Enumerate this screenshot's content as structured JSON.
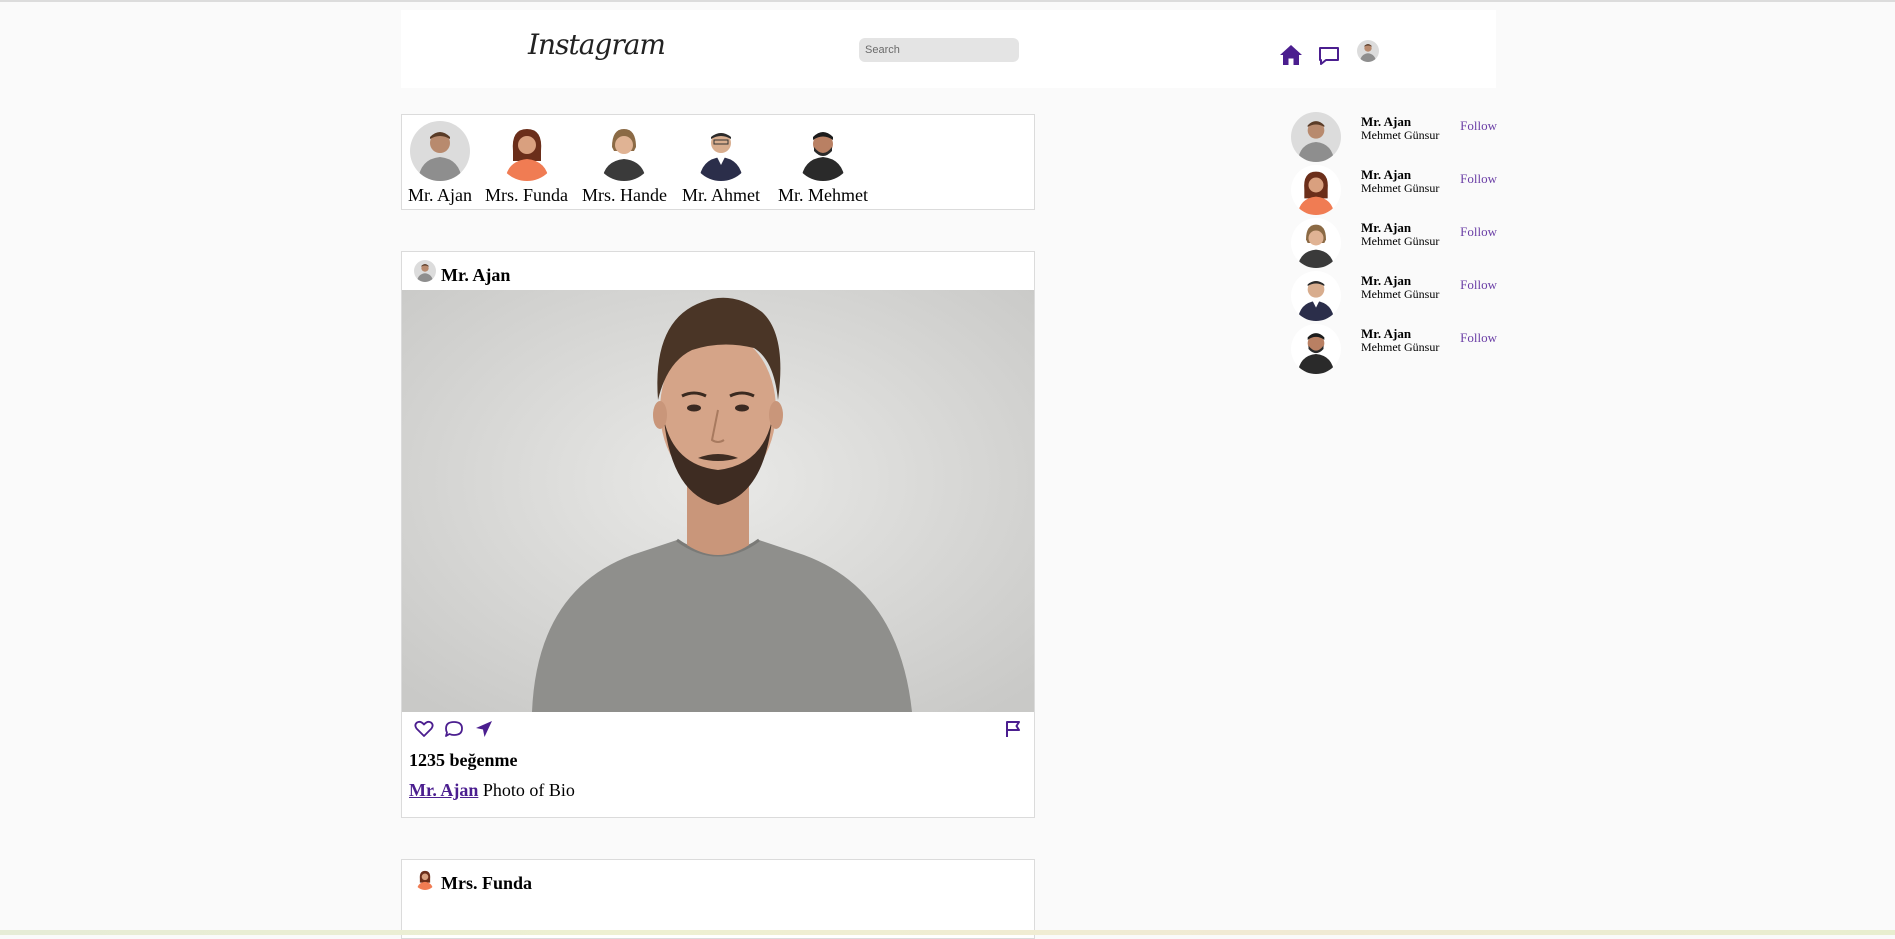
{
  "header": {
    "logo": "Instagram",
    "search_placeholder": "Search",
    "icons": [
      "home-icon",
      "message-icon",
      "profile-avatar"
    ],
    "accent_color": "#4b1e8f"
  },
  "stories": [
    {
      "label": "Mr. Ajan"
    },
    {
      "label": "Mrs. Funda"
    },
    {
      "label": "Mrs. Hande"
    },
    {
      "label": "Mr. Ahmet"
    },
    {
      "label": "Mr. Mehmet"
    }
  ],
  "posts": [
    {
      "user": "Mr. Ajan",
      "likes": "1235 beğenme",
      "caption_user": "Mr. Ajan",
      "caption_text": " Photo of Bio",
      "actions": [
        "heart-icon",
        "comment-icon",
        "share-icon",
        "flag-icon"
      ]
    },
    {
      "user": "Mrs. Funda"
    }
  ],
  "suggestions": [
    {
      "name": "Mr. Ajan",
      "subtitle": "Mehmet Günsur",
      "action": "Follow"
    },
    {
      "name": "Mr. Ajan",
      "subtitle": "Mehmet Günsur",
      "action": "Follow"
    },
    {
      "name": "Mr. Ajan",
      "subtitle": "Mehmet Günsur",
      "action": "Follow"
    },
    {
      "name": "Mr. Ajan",
      "subtitle": "Mehmet Günsur",
      "action": "Follow"
    },
    {
      "name": "Mr. Ajan",
      "subtitle": "Mehmet Günsur",
      "action": "Follow"
    }
  ]
}
